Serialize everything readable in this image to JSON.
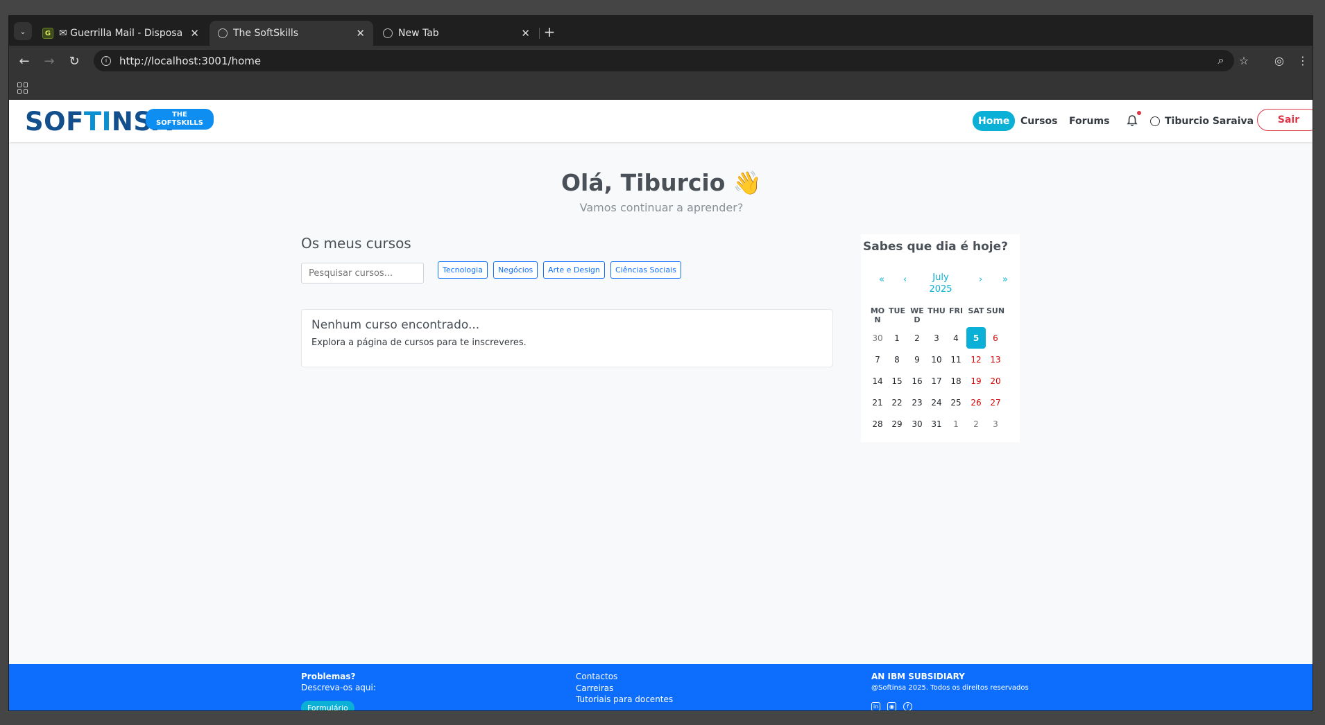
{
  "browser": {
    "tabs": [
      {
        "title": "✉ Guerrilla Mail - Disposa",
        "favicon": "G"
      },
      {
        "title": "The SoftSkills"
      },
      {
        "title": "New Tab"
      }
    ],
    "url": "http://localhost:3001/home"
  },
  "navbar": {
    "logo_part1": "SOF",
    "logo_part2": "TI",
    "logo_part3": "NSA",
    "badge_line1": "THE",
    "badge_line2": "SOFTSKILLS",
    "links": [
      "Home",
      "Cursos",
      "Forums"
    ],
    "user_name": "Tiburcio Saraiva",
    "logout": "Sair"
  },
  "hero": {
    "greeting": "Olá, Tiburcio 👋",
    "subtitle": "Vamos continuar a aprender?"
  },
  "courses": {
    "title": "Os meus cursos",
    "search_placeholder": "Pesquisar cursos...",
    "filters": [
      "Tecnologia",
      "Negócios",
      "Arte e Design",
      "Ciências Sociais"
    ],
    "empty_title": "Nenhum curso encontrado...",
    "empty_text": "Explora a página de cursos para te inscreveres."
  },
  "calendar": {
    "title": "Sabes que dia é hoje?",
    "nav": {
      "prev_year": "«",
      "prev": "‹",
      "next": "›",
      "next_year": "»"
    },
    "month": "July",
    "year": "2025",
    "weekdays": [
      "MON",
      "TUE",
      "WED",
      "THU",
      "FRI",
      "SAT",
      "SUN"
    ],
    "weeks": [
      [
        "30",
        "1",
        "2",
        "3",
        "4",
        "5",
        "6"
      ],
      [
        "7",
        "8",
        "9",
        "10",
        "11",
        "12",
        "13"
      ],
      [
        "14",
        "15",
        "16",
        "17",
        "18",
        "19",
        "20"
      ],
      [
        "21",
        "22",
        "23",
        "24",
        "25",
        "26",
        "27"
      ],
      [
        "28",
        "29",
        "30",
        "31",
        "1",
        "2",
        "3"
      ]
    ],
    "today": "5",
    "accent": "#0ab0d6",
    "weekend_color": "#d10000"
  },
  "footer": {
    "problems_title": "Problemas?",
    "problems_text": "Descreva-os aqui:",
    "form_button": "Formulário",
    "links": [
      "Contactos",
      "Carreiras",
      "Tutoriais para docentes"
    ],
    "company": "AN IBM SUBSIDIARY",
    "copyright": "@Softinsa 2025. Todos os direitos reservados",
    "social_icons": [
      "linkedin-icon",
      "instagram-icon",
      "facebook-icon"
    ]
  }
}
